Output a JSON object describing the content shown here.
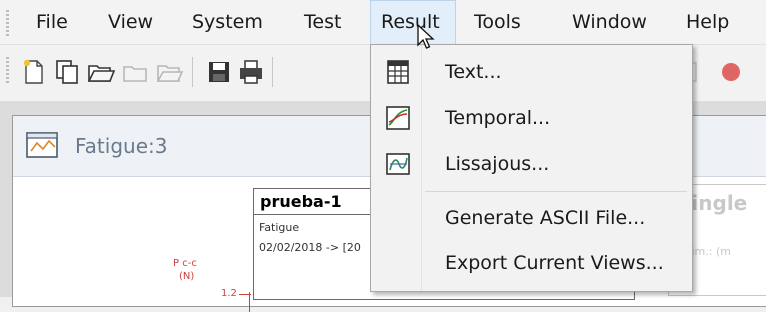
{
  "menubar": {
    "items": [
      {
        "label": "File"
      },
      {
        "label": "View"
      },
      {
        "label": "System"
      },
      {
        "label": "Test"
      },
      {
        "label": "Result"
      },
      {
        "label": "Tools"
      },
      {
        "label": "Window"
      },
      {
        "label": "Help"
      }
    ],
    "active_item": "Result"
  },
  "toolbar": {
    "icons": [
      "new-file-icon",
      "copy-icon",
      "open-folder-icon",
      "folder-disabled-icon",
      "open-disabled-icon",
      "save-icon",
      "print-icon",
      "sort-icon",
      "alert-icon",
      "copy-disabled-icon",
      "export-icon"
    ]
  },
  "result_menu": {
    "items": [
      {
        "label": "Text...",
        "icon": "table-icon"
      },
      {
        "label": "Temporal...",
        "icon": "temporal-chart-icon"
      },
      {
        "label": "Lissajous...",
        "icon": "lissajous-chart-icon"
      },
      {
        "label": "Generate ASCII File...",
        "icon": ""
      },
      {
        "label": "Export Current Views...",
        "icon": ""
      }
    ]
  },
  "document": {
    "title": "Fatigue:3",
    "info": {
      "name": "prueba-1",
      "type": "Fatigue",
      "date": "02/02/2018 -> [20"
    },
    "side_panel": {
      "title": "Single",
      "dim": "Dim.: (m"
    },
    "chart": {
      "y_label_top": "P c-c",
      "y_label_unit": "(N)",
      "y_tick": "1.2"
    }
  },
  "colors": {
    "menu_active_bg": "#e2eef9",
    "dropdown_bg": "#f2f2f2",
    "axis_red": "#d04040"
  }
}
